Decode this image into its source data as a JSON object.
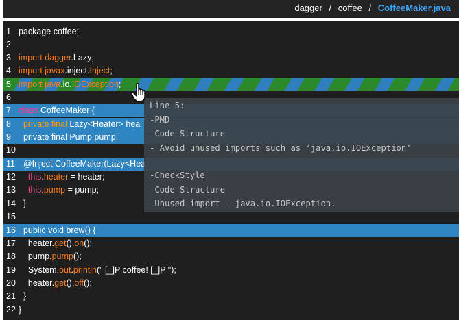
{
  "breadcrumb": {
    "items": [
      "dagger",
      "coffee"
    ],
    "current": "CoffeeMaker.java",
    "separator": "/"
  },
  "code": {
    "lines": [
      {
        "n": "1",
        "tokens": [
          {
            "t": "package coffee;",
            "c": "plain"
          }
        ]
      },
      {
        "n": "2",
        "tokens": []
      },
      {
        "n": "3",
        "tokens": [
          {
            "t": "import ",
            "c": "kw"
          },
          {
            "t": "dagger",
            "c": "kw"
          },
          {
            "t": ".Lazy;",
            "c": "plain"
          }
        ]
      },
      {
        "n": "4",
        "tokens": [
          {
            "t": "import ",
            "c": "kw"
          },
          {
            "t": "javax",
            "c": "kw"
          },
          {
            "t": ".inject.",
            "c": "plain"
          },
          {
            "t": "Inject",
            "c": "kw"
          },
          {
            "t": ";",
            "c": "plain"
          }
        ]
      },
      {
        "n": "5",
        "tokens": [
          {
            "t": "import ",
            "c": "kw"
          },
          {
            "t": "java",
            "c": "kw"
          },
          {
            "t": ".io.",
            "c": "plain"
          },
          {
            "t": "IOException",
            "c": "kw"
          },
          {
            "t": ";",
            "c": "plain"
          }
        ],
        "highlight": "striped"
      },
      {
        "n": "6",
        "tokens": []
      },
      {
        "n": "7",
        "tokens": [
          {
            "t": "class ",
            "c": "kw-pink"
          },
          {
            "t": "CoffeeMaker {",
            "c": "plain"
          }
        ],
        "highlight": "sel"
      },
      {
        "n": "8",
        "tokens": [
          {
            "t": "  private final ",
            "c": "gr"
          },
          {
            "t": "Lazy<Heater> hea",
            "c": "plain"
          }
        ],
        "highlight": "sel"
      },
      {
        "n": "9",
        "tokens": [
          {
            "t": "  private final Pump pump;",
            "c": "plain"
          }
        ],
        "highlight": "sel"
      },
      {
        "n": "10",
        "tokens": []
      },
      {
        "n": "11",
        "tokens": [
          {
            "t": "  @Inject CoffeeMaker(Lazy<Hea",
            "c": "plain"
          }
        ],
        "highlight": "sel"
      },
      {
        "n": "12",
        "tokens": [
          {
            "t": "    this",
            "c": "kw-pink"
          },
          {
            "t": ".",
            "c": "plain"
          },
          {
            "t": "heater",
            "c": "kw"
          },
          {
            "t": " = heater;",
            "c": "plain"
          }
        ]
      },
      {
        "n": "13",
        "tokens": [
          {
            "t": "    this",
            "c": "kw-pink"
          },
          {
            "t": ".",
            "c": "plain"
          },
          {
            "t": "pump",
            "c": "kw"
          },
          {
            "t": " = pump;",
            "c": "plain"
          }
        ]
      },
      {
        "n": "14",
        "tokens": [
          {
            "t": "  }",
            "c": "plain"
          }
        ]
      },
      {
        "n": "15",
        "tokens": []
      },
      {
        "n": "16",
        "tokens": [
          {
            "t": "  public void brew() {",
            "c": "plain"
          }
        ],
        "highlight": "sel"
      },
      {
        "n": "17",
        "tokens": [
          {
            "t": "    heater.",
            "c": "plain"
          },
          {
            "t": "get",
            "c": "kw"
          },
          {
            "t": "().",
            "c": "plain"
          },
          {
            "t": "on",
            "c": "kw"
          },
          {
            "t": "();",
            "c": "plain"
          }
        ]
      },
      {
        "n": "18",
        "tokens": [
          {
            "t": "    pump.",
            "c": "plain"
          },
          {
            "t": "pump",
            "c": "kw"
          },
          {
            "t": "();",
            "c": "plain"
          }
        ]
      },
      {
        "n": "19",
        "tokens": [
          {
            "t": "    System.",
            "c": "plain"
          },
          {
            "t": "out",
            "c": "kw"
          },
          {
            "t": ".",
            "c": "plain"
          },
          {
            "t": "println",
            "c": "kw"
          },
          {
            "t": "(\" [_]P coffee! [_]P \");",
            "c": "plain"
          }
        ]
      },
      {
        "n": "20",
        "tokens": [
          {
            "t": "    heater.",
            "c": "plain"
          },
          {
            "t": "get",
            "c": "kw"
          },
          {
            "t": "().",
            "c": "plain"
          },
          {
            "t": "off",
            "c": "kw"
          },
          {
            "t": "();",
            "c": "plain"
          }
        ]
      },
      {
        "n": "21",
        "tokens": [
          {
            "t": "  }",
            "c": "plain"
          }
        ]
      },
      {
        "n": "22",
        "tokens": [
          {
            "t": "}",
            "c": "plain"
          }
        ]
      }
    ]
  },
  "tooltip": {
    "title": "Line 5:",
    "group1": [
      "-PMD",
      "-Code Structure",
      "- Avoid unused imports such as 'java.io.IOException'"
    ],
    "group2": [
      "-CheckStyle",
      "-Code Structure",
      "-Unused import - java.io.IOException."
    ]
  },
  "icons": {
    "cursor": "hand-pointer-icon"
  },
  "colors": {
    "header_bg": "#232323",
    "editor_bg": "#1f1f1f",
    "selection": "#2f84c2",
    "keyword": "#ff7a1a",
    "keyword_pink": "#ff3f8a",
    "breadcrumb_active": "#3ea6ff"
  }
}
